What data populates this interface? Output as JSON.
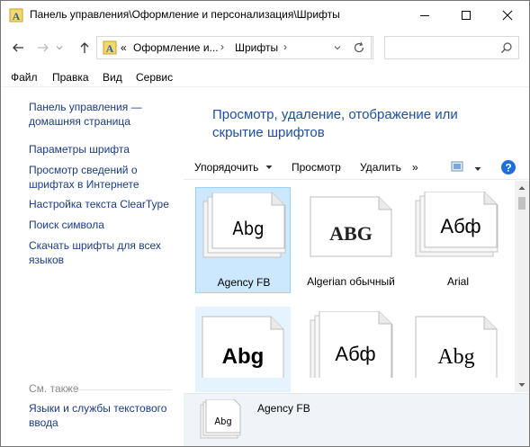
{
  "window": {
    "title": "Панель управления\\Оформление и персонализация\\Шрифты"
  },
  "address": {
    "overflow": "«",
    "crumbs": [
      "Оформление и...",
      "Шрифты"
    ]
  },
  "search": {
    "placeholder": ""
  },
  "menu": [
    "Файл",
    "Правка",
    "Вид",
    "Сервис"
  ],
  "sidebar": {
    "links": [
      "Панель управления — домашняя страница",
      "Параметры шрифта",
      "Просмотр сведений о шрифтах в Интернете",
      "Настройка текста ClearType",
      "Поиск символа",
      "Скачать шрифты для всех языков"
    ],
    "see_also_label": "См. также",
    "see_also_links": [
      "Языки и службы текстового ввода"
    ]
  },
  "content": {
    "heading": "Просмотр, удаление, отображение или скрытие шрифтов"
  },
  "toolbar": {
    "organize": "Упорядочить",
    "preview": "Просмотр",
    "delete": "Удалить",
    "more": "»",
    "help": "?"
  },
  "fonts": [
    {
      "label": "Agency FB",
      "sample": "Abg",
      "state": "selected"
    },
    {
      "label": "Algerian обычный",
      "sample": "ABG",
      "state": "normal"
    },
    {
      "label": "Arial",
      "sample": "Абф",
      "state": "normal"
    },
    {
      "label": "",
      "sample": "Abg",
      "state": "hover"
    },
    {
      "label": "",
      "sample": "Абф",
      "state": "normal"
    },
    {
      "label": "",
      "sample": "Abg",
      "state": "normal"
    }
  ],
  "details": {
    "name": "Agency FB",
    "sample": "Abg"
  }
}
